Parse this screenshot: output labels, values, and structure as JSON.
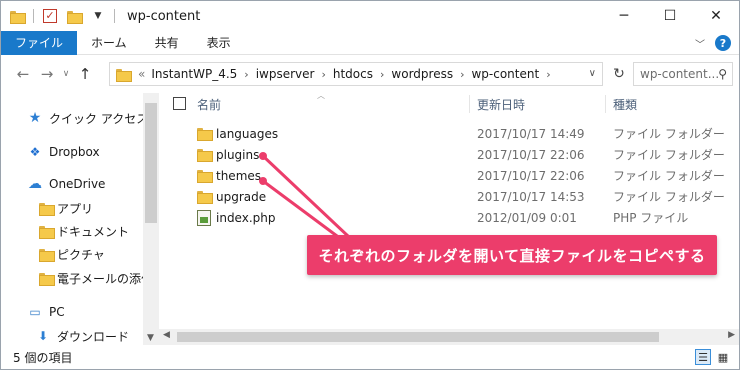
{
  "window": {
    "title": "wp-content",
    "controls": {
      "minimize": "─",
      "maximize": "☐",
      "close": "✕"
    }
  },
  "ribbon": {
    "tabs": [
      "ファイル",
      "ホーム",
      "共有",
      "表示"
    ],
    "help": "?"
  },
  "address": {
    "overflow": "«",
    "crumbs": [
      "InstantWP_4.5",
      "iwpserver",
      "htdocs",
      "wordpress",
      "wp-content"
    ],
    "search_placeholder": "wp-content..."
  },
  "nav": {
    "items": [
      {
        "label": "クイック アクセス",
        "icon": "star-icon"
      },
      {
        "label": "Dropbox",
        "icon": "dropbox-icon"
      },
      {
        "label": "OneDrive",
        "icon": "cloud-icon"
      },
      {
        "label": "アプリ",
        "icon": "folder-icon"
      },
      {
        "label": "ドキュメント",
        "icon": "folder-icon"
      },
      {
        "label": "ピクチャ",
        "icon": "folder-icon"
      },
      {
        "label": "電子メールの添付フ",
        "icon": "folder-icon"
      },
      {
        "label": "PC",
        "icon": "pc-icon"
      },
      {
        "label": "ダウンロード",
        "icon": "download-icon"
      }
    ]
  },
  "files": {
    "columns": {
      "name": "名前",
      "date": "更新日時",
      "type": "種類"
    },
    "rows": [
      {
        "name": "languages",
        "date": "2017/10/17 14:49",
        "type": "ファイル フォルダー",
        "icon": "folder-icon"
      },
      {
        "name": "plugins",
        "date": "2017/10/17 22:06",
        "type": "ファイル フォルダー",
        "icon": "folder-icon"
      },
      {
        "name": "themes",
        "date": "2017/10/17 22:06",
        "type": "ファイル フォルダー",
        "icon": "folder-icon"
      },
      {
        "name": "upgrade",
        "date": "2017/10/17 14:53",
        "type": "ファイル フォルダー",
        "icon": "folder-icon"
      },
      {
        "name": "index.php",
        "date": "2012/01/09 0:01",
        "type": "PHP ファイル",
        "icon": "php-file-icon"
      }
    ]
  },
  "status": {
    "count": "5 個の項目"
  },
  "annotation": {
    "text": "それぞれのフォルダを開いて直接ファイルをコピペする",
    "color": "#ec3d6b"
  }
}
